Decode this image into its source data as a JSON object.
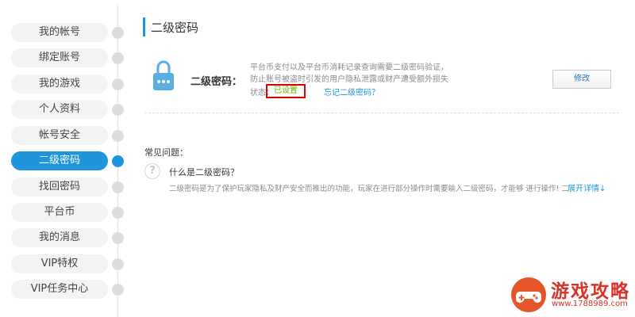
{
  "sidebar": {
    "items": [
      {
        "label": "我的帐号",
        "active": false
      },
      {
        "label": "绑定账号",
        "active": false
      },
      {
        "label": "我的游戏",
        "active": false
      },
      {
        "label": "个人资料",
        "active": false
      },
      {
        "label": "帐号安全",
        "active": false
      },
      {
        "label": "二级密码",
        "active": true
      },
      {
        "label": "找回密码",
        "active": false
      },
      {
        "label": "平台币",
        "active": false
      },
      {
        "label": "我的消息",
        "active": false
      },
      {
        "label": "VIP特权",
        "active": false
      },
      {
        "label": "VIP任务中心",
        "active": false
      }
    ]
  },
  "main": {
    "title": "二级密码",
    "lock_icon": "lock-icon",
    "password_label": "二级密码：",
    "description": [
      "平台币支付以及平台币消耗记录查询需要二级密码验证，",
      "防止账号被盗时引发的用户隐私泄露或财产遭受额外损失"
    ],
    "status_label": "状态：",
    "status_value": "已设置",
    "forgot_link": "忘记二级密码？",
    "modify_button": "修改"
  },
  "faq": {
    "title": "常见问题：",
    "icon": "question-icon",
    "question": "什么是二级密码？",
    "answer": "二级密码是为了保护玩家隐私及财产安全而推出的功能，玩家在进行部分操作时需要输入二级密码，才能够 进行操作! 二",
    "expand": "展开详情↓"
  },
  "watermark": {
    "text": "游戏攻略",
    "url": "www.1788989.com"
  },
  "colors": {
    "accent": "#1f95dc",
    "status_ok": "#6cb100",
    "highlight_box": "#e10000",
    "watermark": "#d8322a"
  }
}
